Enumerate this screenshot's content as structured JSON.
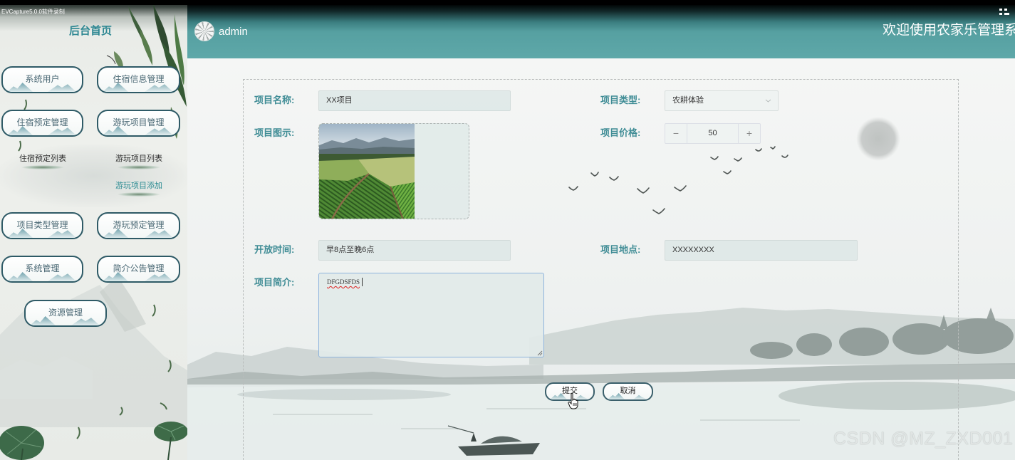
{
  "recorder": {
    "label": "EVCapture5.0.0软件录制"
  },
  "sidebar": {
    "title": "后台首页",
    "menu": [
      {
        "label": "系统用户"
      },
      {
        "label": "住宿信息管理"
      },
      {
        "label": "住宿预定管理",
        "submenu": [
          {
            "label": "住宿预定列表",
            "active": false
          }
        ]
      },
      {
        "label": "游玩项目管理",
        "submenu": [
          {
            "label": "游玩项目列表",
            "active": false
          },
          {
            "label": "游玩项目添加",
            "active": true
          }
        ]
      },
      {
        "label": "项目类型管理"
      },
      {
        "label": "游玩预定管理"
      },
      {
        "label": "系统管理"
      },
      {
        "label": "简介公告管理"
      },
      {
        "label": "资源管理"
      }
    ]
  },
  "header": {
    "avatar_icon": "avatar-icon",
    "username": "admin",
    "welcome": "欢迎使用农家乐管理系统",
    "menu_icon": "grid-icon"
  },
  "form": {
    "name": {
      "label": "项目名称:",
      "value": "XX项目"
    },
    "type": {
      "label": "项目类型:",
      "value": "农耕体验",
      "icon": "chevron-down-icon"
    },
    "image": {
      "label": "项目图示:"
    },
    "price": {
      "label": "项目价格:",
      "value": "50",
      "decrement_label": "−",
      "increment_label": "+"
    },
    "open_time": {
      "label": "开放时间:",
      "value": "早8点至晚6点"
    },
    "location": {
      "label": "项目地点:",
      "value": "XXXXXXXX"
    },
    "intro": {
      "label": "项目简介:",
      "value": "DFGDSFDS"
    },
    "submit_label": "提交",
    "cancel_label": "取消"
  },
  "cursor_icon": "hand-cursor-icon",
  "watermark": "CSDN @MZ_ZXD001",
  "colors": {
    "accent": "#3f8c95",
    "header_teal": "#5ea8a9",
    "active_submenu": "#2c8c93",
    "menu_border": "#2e5a66",
    "focus_border": "#8fb4dd"
  }
}
